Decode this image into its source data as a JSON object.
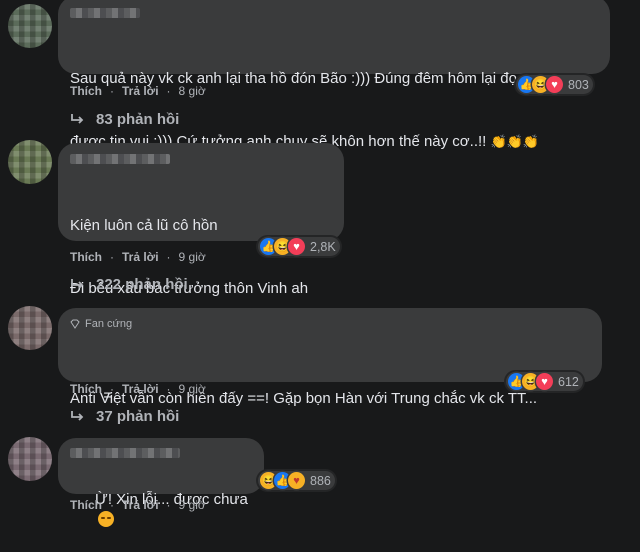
{
  "comments": [
    {
      "text_line1": "Sau quả này vk ck anh lại tha hồ đón Bão :))) Đúng đêm hôm lại đọc",
      "text_line2": "được tin vui :))) Cứ tưởng anh chuy sẽ khôn hơn thế này cơ..!!",
      "reaction_count": "803",
      "like": "Thích",
      "reply": "Trả lời",
      "time": "8 giờ",
      "replies": "83 phản hồi"
    },
    {
      "text_line1": "Kiện luôn cả lũ cô hồn",
      "text_line2": "Đi bêu xấu bác trưởng thôn Vinh ah",
      "text_line3": "=",
      "reaction_count": "2,8K",
      "like": "Thích",
      "reply": "Trả lời",
      "time": "9 giờ",
      "replies": "222 phản hồi"
    },
    {
      "badge": "Fan cứng",
      "text_line1": "Anti Việt vẫn còn hiền đấy ==! Gặp bọn Hàn với Trung chắc vk ck TT...",
      "reaction_count": "612",
      "like": "Thích",
      "reply": "Trả lời",
      "time": "9 giờ",
      "replies": "37 phản hồi"
    },
    {
      "text_line1": "Ừ! Xin lỗi... được chưa",
      "reaction_count": "886",
      "like": "Thích",
      "reply": "Trả lời",
      "time": "9 giờ"
    }
  ],
  "colors": {
    "background": "#18191a",
    "bubble": "#3a3b3c",
    "text": "#e4e6eb",
    "muted": "#b0b3b8",
    "like_blue": "#1877f2",
    "love_red": "#f33e58",
    "haha_yellow": "#f7b125"
  },
  "icons": [
    "like-icon",
    "haha-icon",
    "love-icon",
    "care-icon",
    "clap-icon",
    "reply-arrow-icon",
    "diamond-icon",
    "shadow-icon",
    "sad-emoji-icon"
  ]
}
